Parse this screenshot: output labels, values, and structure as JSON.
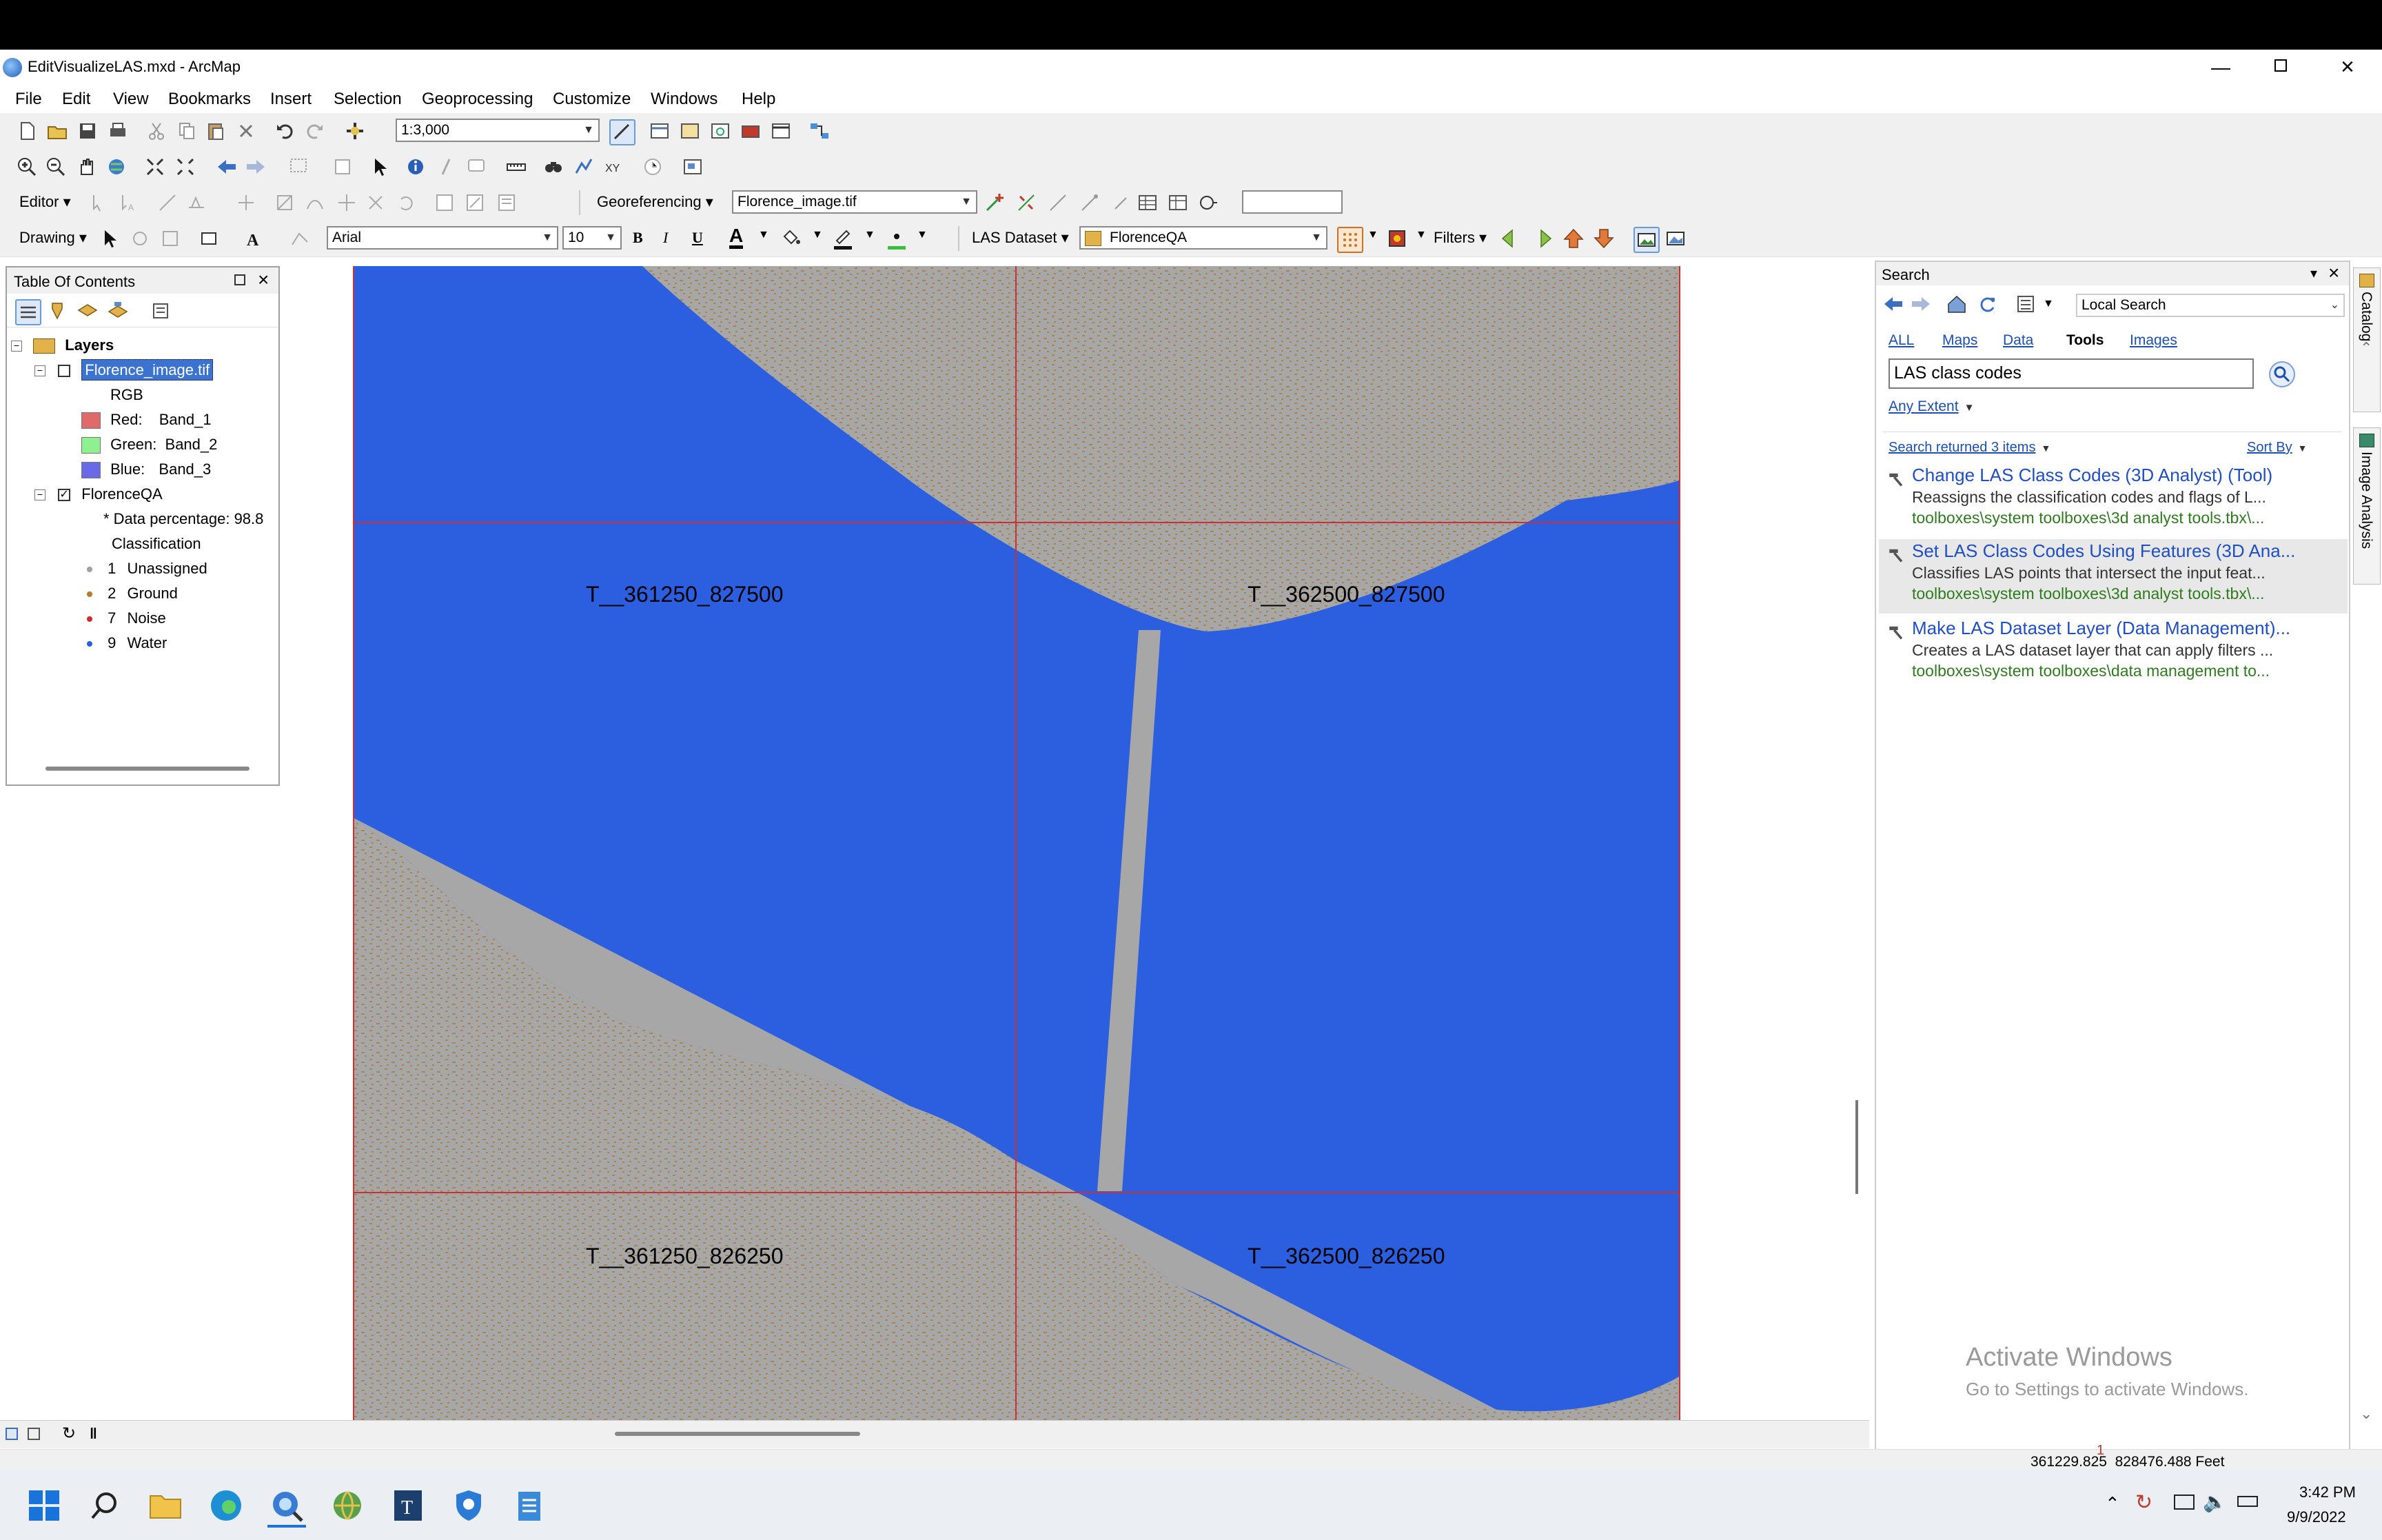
{
  "window": {
    "title": "EditVisualizeLAS.mxd - ArcMap"
  },
  "menu": [
    "File",
    "Edit",
    "View",
    "Bookmarks",
    "Insert",
    "Selection",
    "Geoprocessing",
    "Customize",
    "Windows",
    "Help"
  ],
  "toolbar": {
    "scale": "1:3,000",
    "editor_label": "Editor",
    "georef_label": "Georeferencing",
    "georef_layer": "Florence_image.tif",
    "drawing_label": "Drawing",
    "font_name": "Arial",
    "font_size": "10",
    "bold": "B",
    "italic": "I",
    "underline": "U",
    "font_color_glyph": "A",
    "las_dataset_label": "LAS Dataset",
    "las_layer": "FlorenceQA",
    "filters_label": "Filters"
  },
  "toc": {
    "title": "Table Of Contents",
    "layers_label": "Layers",
    "raster": {
      "name": "Florence_image.tif",
      "rgb": "RGB",
      "bands": [
        {
          "channel": "Red:",
          "band": "Band_1",
          "color": "#e06a6a"
        },
        {
          "channel": "Green:",
          "band": "Band_2",
          "color": "#8ef08e"
        },
        {
          "channel": "Blue:",
          "band": "Band_3",
          "color": "#6a6ae8"
        }
      ]
    },
    "las": {
      "name": "FlorenceQA",
      "data_percentage": "* Data percentage: 98.8",
      "classification": "Classification",
      "classes": [
        {
          "code": "1",
          "label": "Unassigned",
          "color": "#a0a0a0"
        },
        {
          "code": "2",
          "label": "Ground",
          "color": "#b87a28"
        },
        {
          "code": "7",
          "label": "Noise",
          "color": "#d02a2a"
        },
        {
          "code": "9",
          "label": "Water",
          "color": "#2b5fe0"
        }
      ]
    }
  },
  "map": {
    "tile_labels": [
      "T__361250_827500",
      "T__362500_827500",
      "T__361250_826250",
      "T__362500_826250"
    ],
    "colors": {
      "water": "#2b5fe0",
      "unassigned": "#a7a7a7",
      "ground": "#a9782c",
      "grid": "#c83232"
    }
  },
  "search": {
    "title": "Search",
    "scope": "Local Search",
    "tabs": [
      "ALL",
      "Maps",
      "Data",
      "Tools",
      "Images"
    ],
    "active_tab": "Tools",
    "query": "LAS class codes",
    "extent": "Any Extent",
    "returned": "Search returned 3 items",
    "sort": "Sort By",
    "results": [
      {
        "title": "Change LAS Class Codes (3D Analyst) (Tool)",
        "desc": "Reassigns the classification codes and flags of L...",
        "path": "toolboxes\\system toolboxes\\3d analyst tools.tbx\\..."
      },
      {
        "title": "Set LAS Class Codes Using Features (3D Ana...",
        "desc": "Classifies LAS points that intersect the input feat...",
        "path": "toolboxes\\system toolboxes\\3d analyst tools.tbx\\..."
      },
      {
        "title": "Make LAS Dataset Layer (Data Management)...",
        "desc": "Creates a LAS dataset layer that can apply filters ...",
        "path": "toolboxes\\system toolboxes\\data management to..."
      }
    ]
  },
  "side_tabs": [
    "Catalog",
    "Image Analysis"
  ],
  "watermark": {
    "line1": "Activate Windows",
    "line2": "Go to Settings to activate Windows."
  },
  "status": {
    "page": "1",
    "coords": "361229.825  828476.488 Feet"
  },
  "taskbar": {
    "time": "3:42 PM",
    "date": "9/9/2022"
  }
}
